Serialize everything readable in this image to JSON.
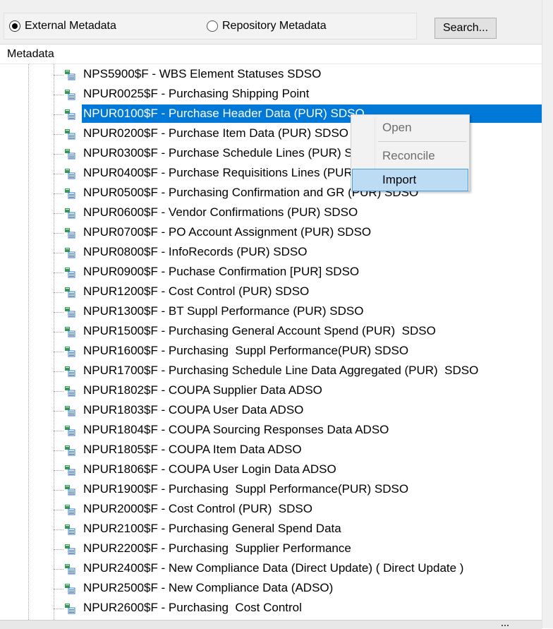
{
  "radio": {
    "external_label": "External Metadata",
    "external_selected": true,
    "repository_label": "Repository Metadata",
    "repository_selected": false
  },
  "search_button": "Search...",
  "column_header": "Metadata",
  "colors": {
    "selection": "#0078d7",
    "menu_hover": "#bcdcf4",
    "icon_green": "#2e9e4f",
    "icon_blue": "#3a78c8"
  },
  "tree_items": [
    {
      "label": "NPS5900$F - WBS Element Statuses SDSO",
      "icon": "table-icon",
      "selected": false
    },
    {
      "label": "NPUR0025$F - Purchasing Shipping Point",
      "icon": "table-icon",
      "selected": false
    },
    {
      "label": "NPUR0100$F - Purchase Header Data (PUR) SDSO",
      "icon": "table-icon",
      "selected": true
    },
    {
      "label": "NPUR0200$F - Purchase Item Data (PUR) SDSO",
      "icon": "table-icon",
      "selected": false
    },
    {
      "label": "NPUR0300$F - Purchase Schedule Lines (PUR) SDSO",
      "icon": "table-icon",
      "selected": false
    },
    {
      "label": "NPUR0400$F - Purchase Requisitions Lines (PUR) SDSO",
      "icon": "table-icon",
      "selected": false
    },
    {
      "label": "NPUR0500$F - Purchasing Confirmation and GR (PUR) SDSO",
      "icon": "table-icon",
      "selected": false
    },
    {
      "label": "NPUR0600$F - Vendor Confirmations (PUR) SDSO",
      "icon": "table-icon",
      "selected": false
    },
    {
      "label": "NPUR0700$F - PO Account Assignment (PUR) SDSO",
      "icon": "table-icon",
      "selected": false
    },
    {
      "label": "NPUR0800$F - InfoRecords (PUR) SDSO",
      "icon": "table-icon",
      "selected": false
    },
    {
      "label": "NPUR0900$F - Puchase Confirmation [PUR] SDSO",
      "icon": "table-icon",
      "selected": false
    },
    {
      "label": "NPUR1200$F - Cost Control (PUR) SDSO",
      "icon": "table-icon",
      "selected": false
    },
    {
      "label": "NPUR1300$F - BT Suppl Performance (PUR) SDSO",
      "icon": "table-icon",
      "selected": false
    },
    {
      "label": "NPUR1500$F - Purchasing General Account Spend (PUR)  SDSO",
      "icon": "table-icon",
      "selected": false
    },
    {
      "label": "NPUR1600$F - Purchasing  Suppl Performance(PUR) SDSO",
      "icon": "table-icon",
      "selected": false
    },
    {
      "label": "NPUR1700$F - Purchasing Schedule Line Data Aggregated (PUR)  SDSO",
      "icon": "table-icon",
      "selected": false
    },
    {
      "label": "NPUR1802$F - COUPA Supplier Data ADSO",
      "icon": "table-icon",
      "selected": false
    },
    {
      "label": "NPUR1803$F - COUPA User Data ADSO",
      "icon": "table-icon",
      "selected": false
    },
    {
      "label": "NPUR1804$F - COUPA Sourcing Responses Data ADSO",
      "icon": "table-icon",
      "selected": false
    },
    {
      "label": "NPUR1805$F - COUPA Item Data ADSO",
      "icon": "table-icon",
      "selected": false
    },
    {
      "label": "NPUR1806$F - COUPA User Login Data ADSO",
      "icon": "table-icon",
      "selected": false
    },
    {
      "label": "NPUR1900$F - Purchasing  Suppl Performance(PUR) SDSO",
      "icon": "table-icon",
      "selected": false
    },
    {
      "label": "NPUR2000$F - Cost Control (PUR)  SDSO",
      "icon": "table-icon",
      "selected": false
    },
    {
      "label": "NPUR2100$F - Purchasing General Spend Data",
      "icon": "table-icon",
      "selected": false
    },
    {
      "label": "NPUR2200$F - Purchasing  Supplier Performance",
      "icon": "table-icon",
      "selected": false
    },
    {
      "label": "NPUR2400$F - New Compliance Data (Direct Update) ( Direct Update )",
      "icon": "table-icon",
      "selected": false
    },
    {
      "label": "NPUR2500$F - New Compliance Data (ADSO)",
      "icon": "table-icon",
      "selected": false
    },
    {
      "label": "NPUR2600$F - Purchasing  Cost Control",
      "icon": "table-icon",
      "selected": false
    }
  ],
  "context_menu": {
    "open": {
      "label": "Open",
      "enabled": false
    },
    "reconcile": {
      "label": "Reconcile",
      "enabled": false
    },
    "import": {
      "label": "Import",
      "enabled": true,
      "hovered": true
    }
  }
}
